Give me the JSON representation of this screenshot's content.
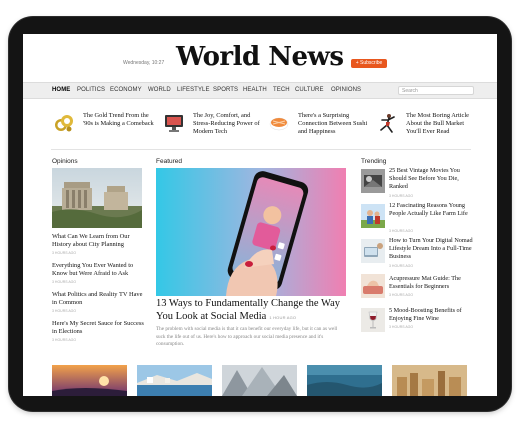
{
  "header": {
    "date": "Wednesday, 10:27",
    "logo": "World News",
    "subscribe_label": "+ Subscribe"
  },
  "nav": {
    "items": [
      "HOME",
      "POLITICS",
      "ECONOMY",
      "WORLD",
      "LIFESTYLE",
      "SPORTS",
      "HEALTH",
      "TECH",
      "CULTURE",
      "OPINIONS"
    ],
    "active": "HOME",
    "search_placeholder": "Search"
  },
  "top_strip": [
    {
      "text": "The Gold Trend From the '90s is Making a Comeback",
      "icon": "gold-jewelry-icon"
    },
    {
      "text": "The Joy, Comfort, and Stress-Reducing Power of Modern Tech",
      "icon": "monitor-icon"
    },
    {
      "text": "There's a Surprising Connection Between Sushi and Happiness",
      "icon": "sushi-icon"
    },
    {
      "text": "The Most Boring Article About the Bull Market You'll Ever Read",
      "icon": "dancer-icon"
    }
  ],
  "opinions": {
    "label": "Opinions",
    "items": [
      {
        "title": "What Can We Learn from Our History about City Planning",
        "meta": "3 HOURS AGO"
      },
      {
        "title": "Everything You Ever Wanted to Know but Were Afraid to Ask",
        "meta": "3 HOURS AGO"
      },
      {
        "title": "What Politics and Reality TV Have in Common",
        "meta": "3 HOURS AGO"
      },
      {
        "title": "Here's My Secret Sauce for Success in Elections",
        "meta": "3 HOURS AGO"
      }
    ]
  },
  "featured": {
    "label": "Featured",
    "title": "13 Ways to Fundamentally Change the Way You Look at Social Media",
    "time": "1 HOUR AGO",
    "description": "The problem with social media is that it can benefit our everyday life, but it can as well suck the life out of us. Here's how to approach our social media presence and it's consumption."
  },
  "trending": {
    "label": "Trending",
    "items": [
      {
        "title": "25 Best Vintage Movies You Should See Before You Die, Ranked",
        "meta": "3 HOURS AGO"
      },
      {
        "title": "12 Fascinating Reasons Young People Actually Like Farm Life",
        "meta": "3 HOURS AGO"
      },
      {
        "title": "How to Turn Your Digital Nomad Lifestyle Dream Into a Full-Time Business",
        "meta": "3 HOURS AGO"
      },
      {
        "title": "Acupressure Mat Guide: The Essentials for Beginners",
        "meta": "3 HOURS AGO"
      },
      {
        "title": "5 Mood-Boosting Benefits of Enjoying Fine Wine",
        "meta": "3 HOURS AGO"
      }
    ]
  },
  "colors": {
    "accent": "#e8571e",
    "nav_bg": "#eeeeee",
    "device_frame": "#141414"
  }
}
